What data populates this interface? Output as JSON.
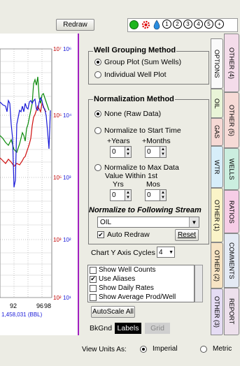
{
  "toolbar": {
    "redraw_label": "Redraw",
    "numbered_buttons": [
      "1",
      "2",
      "3",
      "4",
      "5",
      "+"
    ]
  },
  "chart": {
    "axis_labels": [
      "10⁷",
      "10⁶",
      "10⁵",
      "10⁴",
      "10³",
      "10²",
      "10¹",
      "10⁰"
    ],
    "x_ticks": [
      "92",
      "96",
      "98"
    ],
    "total_label": "1,458,031 (BBL)"
  },
  "grouping": {
    "title": "Well Grouping Method",
    "options": [
      "Group Plot (Sum Wells)",
      "Individual Well Plot"
    ],
    "selected": 0
  },
  "normalization": {
    "title": "Normalization Method",
    "none_label": "None (Raw Data)",
    "start_label": "Normalize to Start Time",
    "years_label": "+Years",
    "months_label": "+Months",
    "years_value": "0",
    "months_value": "0",
    "max_label": "Normalize to Max Data",
    "within_label": "Value Within 1st",
    "yrs_label": "Yrs",
    "mos_label": "Mos",
    "yrs_value": "0",
    "mos_value": "0",
    "stream_title": "Normalize to Following Stream",
    "stream_value": "OIL",
    "auto_redraw_label": "Auto Redraw",
    "reset_label": "Reset"
  },
  "chart_y_axis": {
    "label": "Chart Y Axis Cycles",
    "value": "4"
  },
  "options_list": [
    {
      "label": "Show Well Counts",
      "checked": false
    },
    {
      "label": "Use Aliases",
      "checked": true
    },
    {
      "label": "Show Daily Rates",
      "checked": false
    },
    {
      "label": "Show Average Prod/Well",
      "checked": false
    }
  ],
  "autoscale_label": "AutoScale All",
  "bottom_tabs": [
    "BkGnd",
    "Labels",
    "Grid"
  ],
  "inner_tabs": [
    "OPTIONS",
    "OIL",
    "GAS",
    "WTR",
    "OTHER (1)",
    "OTHER (2)",
    "OTHER (3)"
  ],
  "outer_tabs": [
    "OTHER (4)",
    "OTHER (5)",
    "WELLS",
    "RATIOS",
    "COMMENTS",
    "REPORT"
  ],
  "view_units": {
    "label": "View Units As:",
    "options": [
      "Imperial",
      "Metric"
    ],
    "selected": 0
  },
  "colors": {
    "accent_border": "#a020c0",
    "oil_tab": "#e9f5d8",
    "gas_tab": "#f6d9d5",
    "wtr_tab": "#d7eefa",
    "other1_tab": "#fbf4c8",
    "other2_tab": "#f7e4c4",
    "other3_tab": "#e5dcf4",
    "other4_tab": "#f4dcea",
    "other5_tab": "#f6dad6",
    "wells_tab": "#cbeedf",
    "ratios_tab": "#f6cde6",
    "comments_tab": "#e4eaf4",
    "report_tab": "#ede0ec"
  }
}
